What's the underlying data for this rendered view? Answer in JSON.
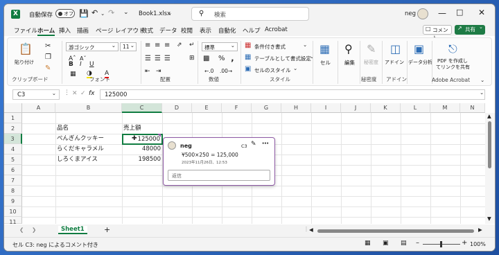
{
  "titlebar": {
    "autosave_label": "自動保存",
    "autosave_state": "オフ",
    "filename": "Book1.xlsx",
    "search_placeholder": "検索",
    "user": "neg"
  },
  "tabs": [
    "ファイル",
    "ホーム",
    "挿入",
    "描画",
    "ページ レイアウト",
    "数式",
    "データ",
    "校閲",
    "表示",
    "自動化",
    "ヘルプ",
    "Acrobat"
  ],
  "tab_actions": {
    "comment": "コメント",
    "share": "共有"
  },
  "ribbon": {
    "clipboard": {
      "paste": "貼り付け",
      "label": "クリップボード"
    },
    "font": {
      "name": "游ゴシック",
      "size": "11",
      "label": "フォント"
    },
    "alignment": {
      "label": "配置"
    },
    "number": {
      "format": "標準",
      "label": "数値"
    },
    "styles": {
      "conditional": "条件付き書式",
      "table": "テーブルとして書式設定",
      "cell_style": "セルのスタイル",
      "label": "スタイル"
    },
    "cells": {
      "label": "セル"
    },
    "editing": {
      "label": "編集"
    },
    "sensitivity": {
      "btn": "秘密度",
      "label": "秘密度"
    },
    "addins": {
      "btn": "アドイン",
      "label": "アドイン"
    },
    "analysis": {
      "btn": "データ分析"
    },
    "acrobat": {
      "btn1": "PDF を作成し",
      "btn2": "てリンクを共有",
      "label": "Adobe Acrobat"
    }
  },
  "formula_bar": {
    "name_box": "C3",
    "fx": "fx",
    "value": "125000"
  },
  "columns": [
    "A",
    "B",
    "C",
    "D",
    "E",
    "F",
    "G",
    "H",
    "I",
    "J",
    "K",
    "L",
    "M",
    "N"
  ],
  "rows": [
    "1",
    "2",
    "3",
    "4",
    "5",
    "6",
    "7",
    "8",
    "9",
    "10",
    "11"
  ],
  "cells": {
    "B2": "品名",
    "C2": "売上額",
    "B3": "ぺんぎんクッキー",
    "C3": "125000",
    "B4": "らくだキャラメル",
    "C4": "48000",
    "B5": "しろくまアイス",
    "C5": "198500"
  },
  "comment": {
    "author": "neg",
    "cell_ref": "C3",
    "text": "¥500×250 = 125,000",
    "timestamp": "2023年11月26日、12:53",
    "reply_placeholder": "返信"
  },
  "sheet_tab": "Sheet1",
  "status": {
    "text": "セル C3: neg によるコメント付き",
    "zoom": "100%"
  },
  "colors": {
    "excel_green": "#107c41",
    "comment_border": "#8e5aa5",
    "share_green": "#1e7b45"
  }
}
